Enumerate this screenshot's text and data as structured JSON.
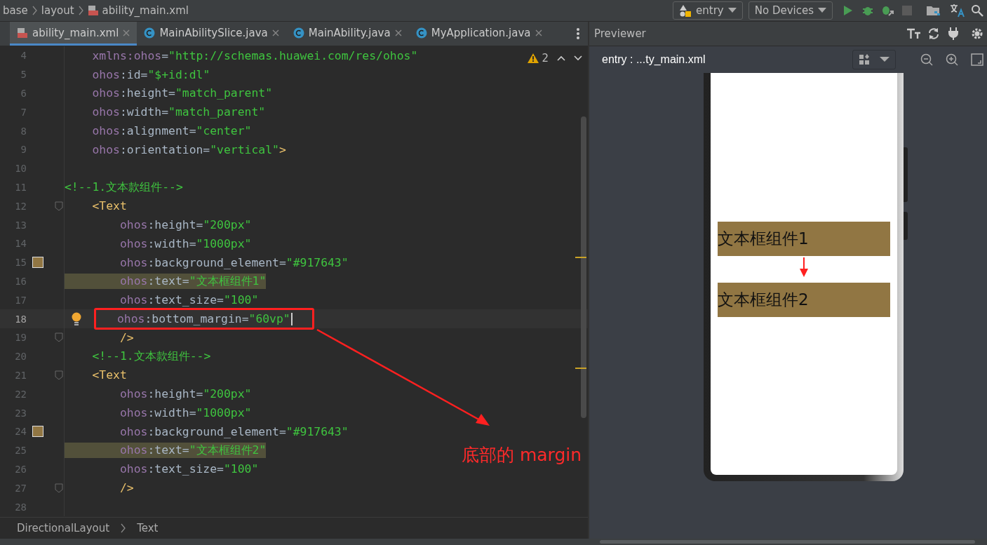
{
  "breadcrumb": [
    "base",
    "layout",
    "ability_main.xml"
  ],
  "toolbar": {
    "module": "entry",
    "device": "No Devices"
  },
  "tabs": [
    {
      "label": "ability_main.xml",
      "kind": "xml",
      "selected": true
    },
    {
      "label": "MainAbilitySlice.java",
      "kind": "class",
      "selected": false
    },
    {
      "label": "MainAbility.java",
      "kind": "class",
      "selected": false
    },
    {
      "label": "MyApplication.java",
      "kind": "class",
      "selected": false
    }
  ],
  "editor": {
    "warnings": "2",
    "lines": [
      {
        "number": "4",
        "fold": false,
        "highlighted": false,
        "current": false,
        "boxed": false,
        "segments": [
          {
            "kind": "ns",
            "text": "    xmlns:ohos"
          },
          {
            "kind": "plain",
            "text": "="
          },
          {
            "kind": "str",
            "text": "\"http://schemas.huawei.com/res/ohos\""
          }
        ]
      },
      {
        "number": "5",
        "fold": false,
        "highlighted": false,
        "current": false,
        "boxed": false,
        "segments": [
          {
            "kind": "ns",
            "text": "    ohos"
          },
          {
            "kind": "plain",
            "text": ":id="
          },
          {
            "kind": "str",
            "text": "\"$+id:dl\""
          }
        ]
      },
      {
        "number": "6",
        "fold": false,
        "highlighted": false,
        "current": false,
        "boxed": false,
        "segments": [
          {
            "kind": "ns",
            "text": "    ohos"
          },
          {
            "kind": "plain",
            "text": ":height="
          },
          {
            "kind": "str",
            "text": "\"match_parent\""
          }
        ]
      },
      {
        "number": "7",
        "fold": false,
        "highlighted": false,
        "current": false,
        "boxed": false,
        "segments": [
          {
            "kind": "ns",
            "text": "    ohos"
          },
          {
            "kind": "plain",
            "text": ":width="
          },
          {
            "kind": "str",
            "text": "\"match_parent\""
          }
        ]
      },
      {
        "number": "8",
        "fold": false,
        "highlighted": false,
        "current": false,
        "boxed": false,
        "segments": [
          {
            "kind": "ns",
            "text": "    ohos"
          },
          {
            "kind": "plain",
            "text": ":alignment="
          },
          {
            "kind": "str",
            "text": "\"center\""
          }
        ]
      },
      {
        "number": "9",
        "fold": false,
        "highlighted": false,
        "current": false,
        "boxed": false,
        "segments": [
          {
            "kind": "ns",
            "text": "    ohos"
          },
          {
            "kind": "plain",
            "text": ":orientation="
          },
          {
            "kind": "str",
            "text": "\"vertical\""
          },
          {
            "kind": "tag",
            "text": ">"
          }
        ]
      },
      {
        "number": "10",
        "fold": false,
        "current": false
      },
      {
        "number": "11",
        "fold": false,
        "highlighted": false,
        "current": false,
        "boxed": false,
        "segments": [
          {
            "kind": "comment",
            "text": "<!--1.文本款组件-->"
          }
        ]
      },
      {
        "number": "12",
        "fold": true,
        "highlighted": false,
        "current": false,
        "boxed": false,
        "segments": [
          {
            "kind": "tag",
            "text": "    <Text"
          }
        ]
      },
      {
        "number": "13",
        "fold": false,
        "highlighted": false,
        "current": false,
        "boxed": false,
        "segments": [
          {
            "kind": "ns",
            "text": "        ohos"
          },
          {
            "kind": "plain",
            "text": ":height="
          },
          {
            "kind": "str",
            "text": "\"200px\""
          }
        ]
      },
      {
        "number": "14",
        "fold": false,
        "highlighted": false,
        "current": false,
        "boxed": false,
        "segments": [
          {
            "kind": "ns",
            "text": "        ohos"
          },
          {
            "kind": "plain",
            "text": ":width="
          },
          {
            "kind": "str",
            "text": "\"1000px\""
          }
        ]
      },
      {
        "number": "15",
        "color": "#917643",
        "fold": false,
        "highlighted": false,
        "current": false,
        "boxed": false,
        "segments": [
          {
            "kind": "ns",
            "text": "        ohos"
          },
          {
            "kind": "plain",
            "text": ":background_element="
          },
          {
            "kind": "str",
            "text": "\"#917643\""
          }
        ]
      },
      {
        "number": "16",
        "fold": false,
        "highlighted": true,
        "current": false,
        "boxed": false,
        "segments": [
          {
            "kind": "ns",
            "text": "        ohos"
          },
          {
            "kind": "plain",
            "text": ":text="
          },
          {
            "kind": "str",
            "text": "\"文本框组件1\""
          }
        ]
      },
      {
        "number": "17",
        "fold": false,
        "highlighted": false,
        "current": false,
        "boxed": false,
        "segments": [
          {
            "kind": "ns",
            "text": "        ohos"
          },
          {
            "kind": "plain",
            "text": ":text_size="
          },
          {
            "kind": "str",
            "text": "\"100\""
          }
        ]
      },
      {
        "number": "18",
        "fold": false,
        "highlighted": false,
        "current": true,
        "boxed": true,
        "segments": [
          {
            "kind": "ns",
            "text": "ohos"
          },
          {
            "kind": "plain",
            "text": ":bottom_margin="
          },
          {
            "kind": "str",
            "text": "\"60vp\""
          }
        ]
      },
      {
        "number": "19",
        "fold": true,
        "highlighted": false,
        "current": false,
        "boxed": false,
        "segments": [
          {
            "kind": "tag",
            "text": "        />"
          }
        ]
      },
      {
        "number": "20",
        "fold": false,
        "highlighted": false,
        "current": false,
        "boxed": false,
        "segments": [
          {
            "kind": "comment",
            "text": "    <!--1.文本款组件-->"
          }
        ]
      },
      {
        "number": "21",
        "fold": true,
        "highlighted": false,
        "current": false,
        "boxed": false,
        "segments": [
          {
            "kind": "tag",
            "text": "    <Text"
          }
        ]
      },
      {
        "number": "22",
        "fold": false,
        "highlighted": false,
        "current": false,
        "boxed": false,
        "segments": [
          {
            "kind": "ns",
            "text": "        ohos"
          },
          {
            "kind": "plain",
            "text": ":height="
          },
          {
            "kind": "str",
            "text": "\"200px\""
          }
        ]
      },
      {
        "number": "23",
        "fold": false,
        "highlighted": false,
        "current": false,
        "boxed": false,
        "segments": [
          {
            "kind": "ns",
            "text": "        ohos"
          },
          {
            "kind": "plain",
            "text": ":width="
          },
          {
            "kind": "str",
            "text": "\"1000px\""
          }
        ]
      },
      {
        "number": "24",
        "color": "#917643",
        "fold": false,
        "highlighted": false,
        "current": false,
        "boxed": false,
        "segments": [
          {
            "kind": "ns",
            "text": "        ohos"
          },
          {
            "kind": "plain",
            "text": ":background_element="
          },
          {
            "kind": "str",
            "text": "\"#917643\""
          }
        ]
      },
      {
        "number": "25",
        "fold": false,
        "highlighted": true,
        "current": false,
        "boxed": false,
        "segments": [
          {
            "kind": "ns",
            "text": "        ohos"
          },
          {
            "kind": "plain",
            "text": ":text="
          },
          {
            "kind": "str",
            "text": "\"文本框组件2\""
          }
        ]
      },
      {
        "number": "26",
        "fold": false,
        "highlighted": false,
        "current": false,
        "boxed": false,
        "segments": [
          {
            "kind": "ns",
            "text": "        ohos"
          },
          {
            "kind": "plain",
            "text": ":text_size="
          },
          {
            "kind": "str",
            "text": "\"100\""
          }
        ]
      },
      {
        "number": "27",
        "fold": true,
        "highlighted": false,
        "current": false,
        "boxed": false,
        "segments": [
          {
            "kind": "tag",
            "text": "        />"
          }
        ]
      },
      {
        "number": "28",
        "fold": false,
        "current": false
      }
    ]
  },
  "annotation": "底部的 margin",
  "status_path": [
    "DirectionalLayout",
    "Text"
  ],
  "previewer": {
    "title": "Previewer",
    "file": "entry : ...ty_main.xml",
    "texts": [
      {
        "text": "文本框组件1",
        "color": "#917643"
      },
      {
        "text": "文本框组件2",
        "color": "#917643"
      }
    ]
  }
}
